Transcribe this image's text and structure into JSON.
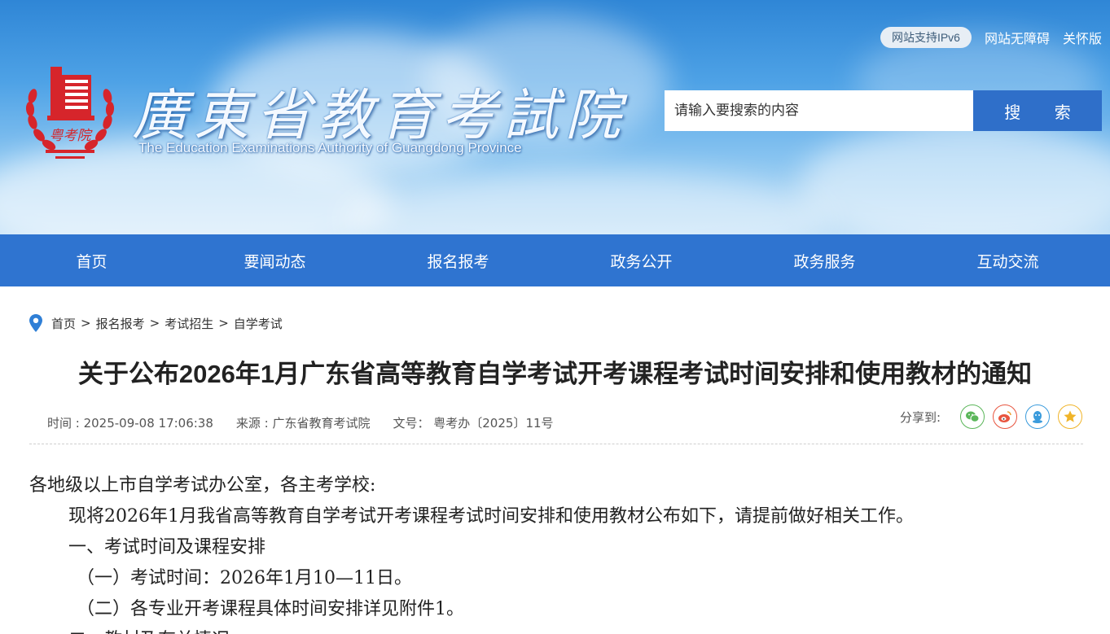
{
  "header": {
    "site_title": "廣東省教育考試院",
    "site_subtitle": "The Education Examinations Authority of Guangdong Province",
    "logo_text": "粤考院",
    "top_links": {
      "ipv6": "网站支持IPv6",
      "accessible": "网站无障碍",
      "elderly": "关怀版"
    },
    "search": {
      "placeholder": "请输入要搜索的内容",
      "button": "搜 索"
    }
  },
  "nav": {
    "items": [
      "首页",
      "要闻动态",
      "报名报考",
      "政务公开",
      "政务服务",
      "互动交流"
    ]
  },
  "breadcrumb": [
    "首页",
    "报名报考",
    "考试招生",
    "自学考试"
  ],
  "breadcrumb_sep": ">",
  "article": {
    "title": "关于公布2026年1月广东省高等教育自学考试开考课程考试时间安排和使用教材的通知",
    "meta": {
      "time": "时间 : 2025-09-08 17:06:38",
      "source": "来源 : 广东省教育考试院",
      "doc_no": "文号： 粤考办〔2025〕11号"
    },
    "share_label": "分享到:",
    "share_icons": [
      {
        "name": "wechat-icon",
        "color": "#5bb65a"
      },
      {
        "name": "weibo-icon",
        "color": "#e8553f"
      },
      {
        "name": "qq-icon",
        "color": "#3a9bdc"
      },
      {
        "name": "qzone-icon",
        "color": "#f0b429"
      }
    ],
    "paragraphs": [
      "各地级以上市自学考试办公室，各主考学校:",
      "现将2026年1月我省高等教育自学考试开考课程考试时间安排和使用教材公布如下，请提前做好相关工作。",
      "一、考试时间及课程安排",
      "（一）考试时间：2026年1月10—11日。",
      "（二）各专业开考课程具体时间安排详见附件1。",
      "二、教材及有关情况"
    ]
  },
  "colors": {
    "nav_bg": "#2f74d0",
    "search_button_bg": "#2f6fc9",
    "logo_red": "#d6252b"
  }
}
